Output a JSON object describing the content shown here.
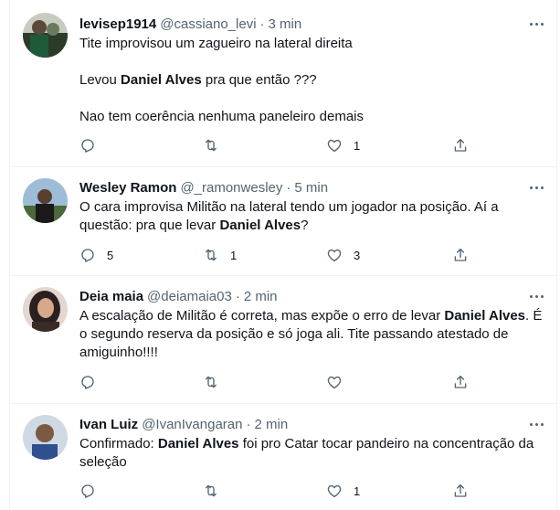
{
  "tweets": [
    {
      "name": "levisep1914",
      "handle": "@cassiano_levi",
      "sep": "·",
      "time": "3 min",
      "lines": [
        [
          "Tite improvisou um zagueiro na lateral direita"
        ],
        [
          "Levou ",
          "Daniel Alves",
          " pra que então ???"
        ],
        [
          "Nao tem coerência nenhuma paneleiro demais"
        ]
      ],
      "replies": "",
      "retweets": "",
      "likes": "1",
      "avatar_colors": [
        "#2c3a2a",
        "#6b7a5c"
      ]
    },
    {
      "name": "Wesley Ramon",
      "handle": "@_ramonwesley",
      "sep": "·",
      "time": "5 min",
      "text_parts": [
        "O cara improvisa Militão na lateral tendo um jogador na posição. Aí a questão: pra que levar ",
        "Daniel Alves",
        "?"
      ],
      "replies": "5",
      "retweets": "1",
      "likes": "3",
      "avatar_colors": [
        "#7fa6c9",
        "#3f5a2c"
      ]
    },
    {
      "name": "Deia maia",
      "handle": "@deiamaia03",
      "sep": "·",
      "time": "2 min",
      "text_parts": [
        "A escalação de Militão é correta, mas expõe o erro de levar ",
        "Daniel Alves",
        ". É o segundo reserva da posição e só joga ali. Tite passando atestado de amiguinho!!!!"
      ],
      "replies": "",
      "retweets": "",
      "likes": "",
      "avatar_colors": [
        "#d9c7c0",
        "#2a2020"
      ]
    },
    {
      "name": "Ivan Luiz",
      "handle": "@IvanIvangaran",
      "sep": "·",
      "time": "2 min",
      "text_parts": [
        "Confirmado: ",
        "Daniel Alves",
        " foi pro Catar tocar pandeiro na concentração da seleção"
      ],
      "replies": "",
      "retweets": "",
      "likes": "1",
      "avatar_colors": [
        "#b9c7d6",
        "#4a3a30"
      ]
    }
  ],
  "icons": {
    "reply": "reply-icon",
    "retweet": "retweet-icon",
    "like": "like-icon",
    "share": "share-icon",
    "more": "more-icon"
  }
}
